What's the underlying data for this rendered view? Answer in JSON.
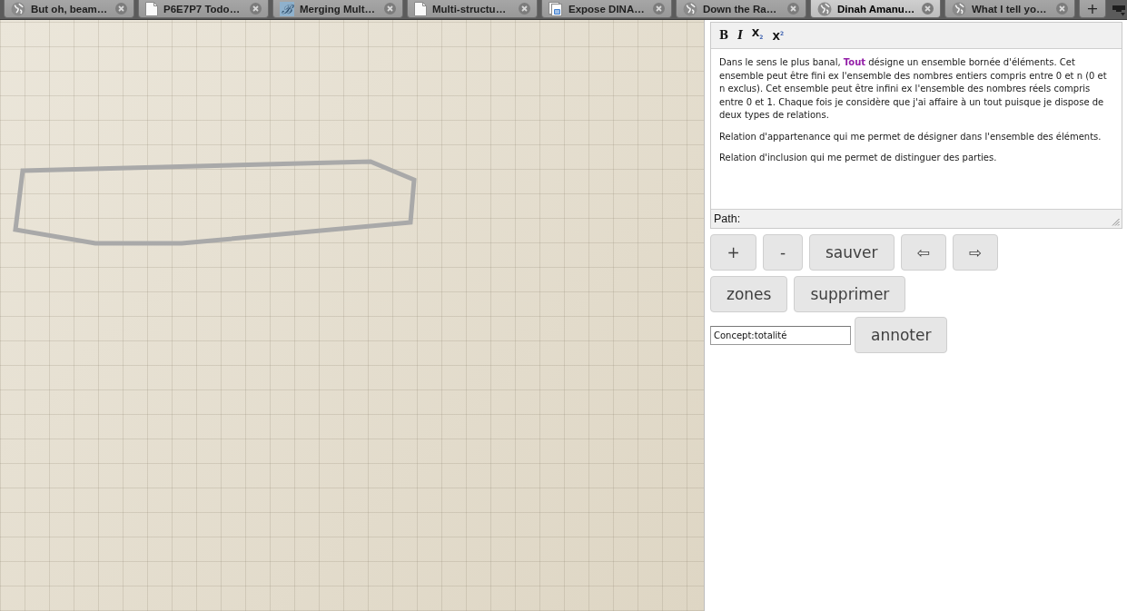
{
  "browser": {
    "tabs": [
      {
        "title": "But oh, beam…",
        "kind": "globe",
        "selected": false
      },
      {
        "title": "P6E7P7 Todo…",
        "kind": "page",
        "selected": false
      },
      {
        "title": "Merging Mult…",
        "kind": "letter",
        "icon_text": "ℬ",
        "selected": false
      },
      {
        "title": "Multi-structu…",
        "kind": "page",
        "selected": false
      },
      {
        "title": "Expose DINA…",
        "kind": "documents",
        "selected": false
      },
      {
        "title": "Down the Ra…",
        "kind": "globe",
        "selected": false
      },
      {
        "title": "Dinah Amanu…",
        "kind": "globe",
        "selected": true
      },
      {
        "title": "What I tell yo…",
        "kind": "globe",
        "selected": false
      }
    ],
    "new_tab": "+"
  },
  "editor": {
    "toolbar": [
      {
        "label": "B",
        "kind": "bold"
      },
      {
        "label": "I",
        "kind": "italic"
      },
      {
        "label": "X$_{2}$",
        "kind": "subscript"
      },
      {
        "label": "X$^{2}$",
        "kind": "superscript"
      }
    ],
    "paragraphs": [
      "Dans le sens le plus banal, **Tout** désigne un ensemble bornée d'éléments. Cet ensemble peut être fini ex l'ensemble des nombres entiers compris entre 0 et n (0 et n exclus). Cet ensemble peut être infini ex l'ensemble des nombres réels compris entre 0 et 1. Chaque fois je considère que j'ai affaire à un tout puisque je dispose de deux types de relations.",
      "Relation d'appartenance qui me permet de désigner dans l'ensemble des éléments.",
      "Relation d'inclusion qui me permet de distinguer des parties."
    ],
    "path_label": "Path:"
  },
  "button_rows": [
    [
      "+",
      "-",
      "sauver",
      "⇦",
      "⇨"
    ],
    [
      "zones",
      "supprimer"
    ]
  ],
  "annotation": {
    "value": "Concept:totalité",
    "button": "annoter"
  }
}
